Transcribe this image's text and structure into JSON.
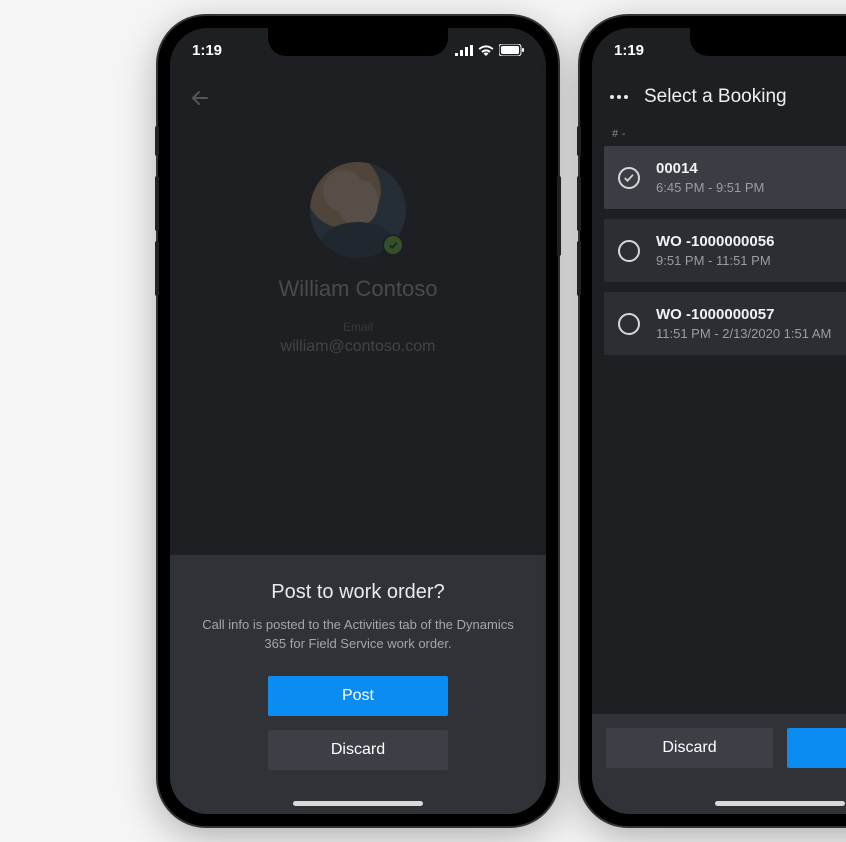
{
  "status": {
    "time": "1:19"
  },
  "left": {
    "profile": {
      "name": "William Contoso",
      "email_label": "Email",
      "email": "william@contoso.com"
    },
    "sheet": {
      "title": "Post to work order?",
      "description": "Call info is posted to the Activities tab of the Dynamics 365 for Field Service work order.",
      "post_label": "Post",
      "discard_label": "Discard"
    }
  },
  "right": {
    "header_title": "Select a Booking",
    "list_header": "# -",
    "items": [
      {
        "title": "00014",
        "subtitle": "6:45 PM - 9:51 PM",
        "selected": true
      },
      {
        "title": "WO -1000000056",
        "subtitle": "9:51 PM - 11:51 PM",
        "selected": false
      },
      {
        "title": "WO -1000000057",
        "subtitle": "11:51 PM - 2/13/2020 1:51 AM",
        "selected": false
      }
    ],
    "discard_label": "Discard"
  },
  "colors": {
    "primary": "#0b8cf2",
    "presence": "#6fce3c"
  }
}
